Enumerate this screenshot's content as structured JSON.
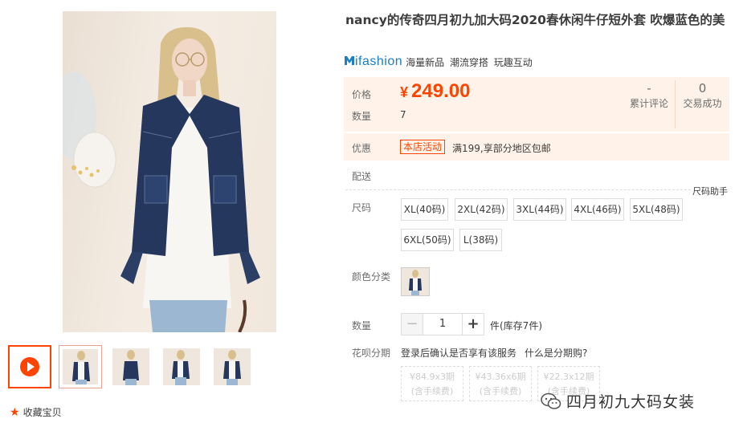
{
  "product": {
    "title": "nancy的传奇四月初九加大码2020春休闲牛仔短外套 吹爆蓝色的美",
    "brand_logo": "ifashion",
    "brand_tags": "海量新品 潮流穿搭 玩趣互动"
  },
  "price": {
    "label": "价格",
    "currency": "¥",
    "amount": "249.00",
    "qty_label": "数量",
    "qty_value": "7",
    "reviews_value": "-",
    "reviews_label": "累计评论",
    "sales_value": "0",
    "sales_label": "交易成功"
  },
  "promo": {
    "label": "优惠",
    "badge": "本店活动",
    "text": "满199,享部分地区包邮"
  },
  "shipping": {
    "label": "配送"
  },
  "size": {
    "helper": "尺码助手",
    "label": "尺码",
    "options": [
      "XL(40码)",
      "2XL(42码)",
      "3XL(44码)",
      "4XL(46码)",
      "5XL(48码)",
      "6XL(50码)",
      "L(38码)"
    ]
  },
  "color": {
    "label": "颜色分类"
  },
  "quantity": {
    "label": "数量",
    "minus": "−",
    "plus": "+",
    "value": "1",
    "stock_text": "件(库存7件)"
  },
  "huabei": {
    "label": "花呗分期",
    "note": "登录后确认是否享有该服务",
    "link": "什么是分期购?",
    "installments": [
      {
        "amount": "¥84.9x3期",
        "fee": "(含手续费)"
      },
      {
        "amount": "¥43.36x6期",
        "fee": "(含手续费)"
      },
      {
        "amount": "¥22.3x12期",
        "fee": "(含手续费)"
      }
    ]
  },
  "favorite": {
    "label": "收藏宝贝"
  },
  "watermark": {
    "text": "四月初九大码女装"
  },
  "icons": [
    "play-icon",
    "star-icon",
    "wechat-icon"
  ],
  "colors": {
    "accent": "#ff4400",
    "price_bg": "#fff2e8",
    "brand": "#1a7ec8"
  }
}
